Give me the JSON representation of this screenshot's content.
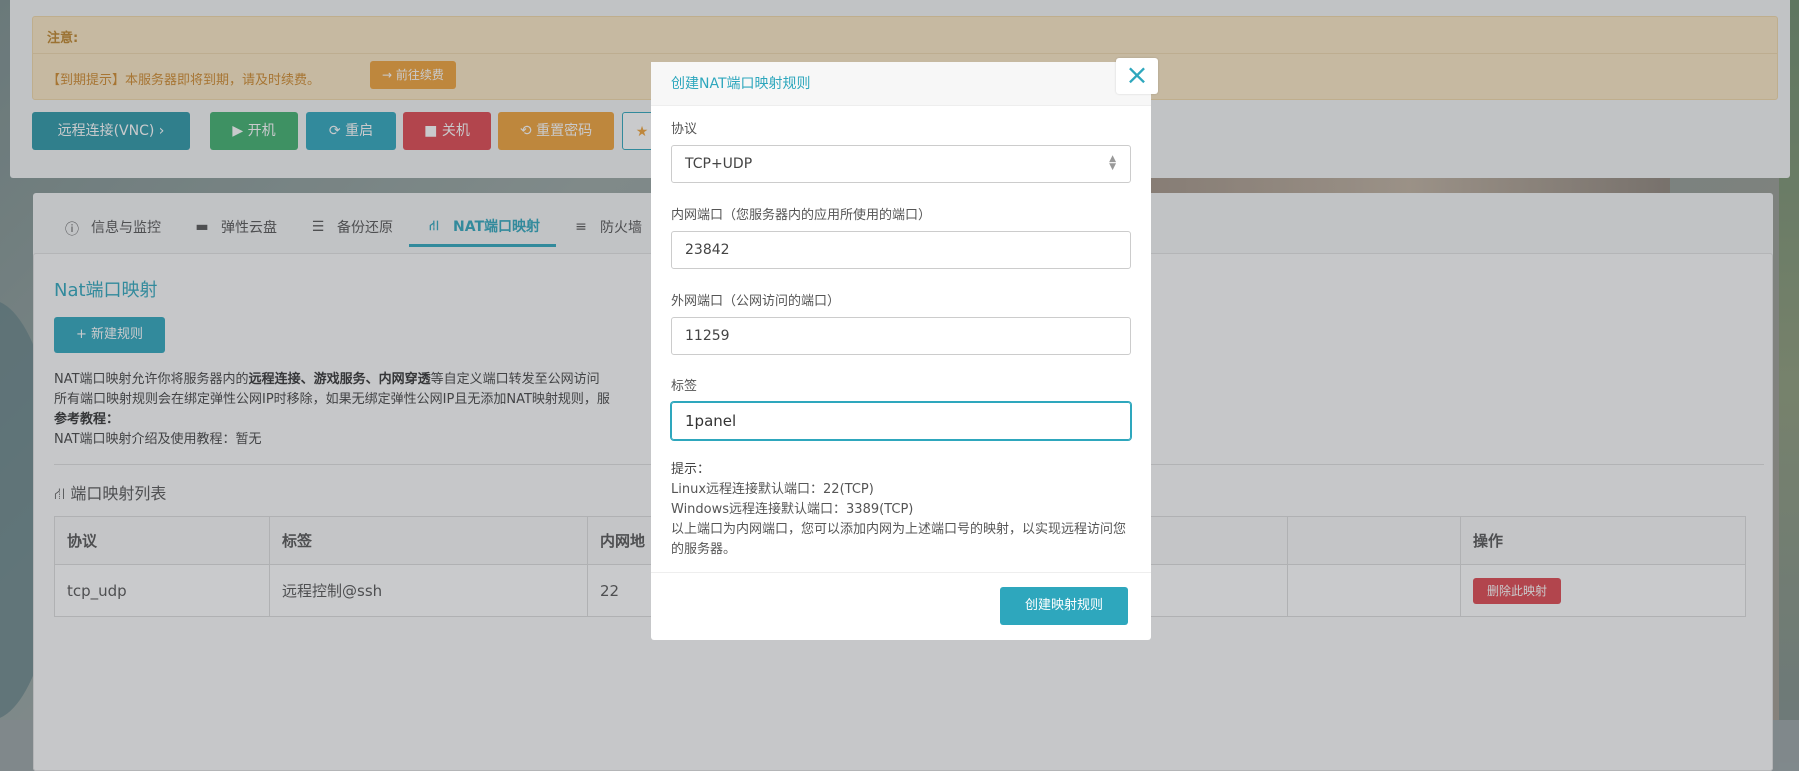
{
  "notice": {
    "title": "注意:",
    "message": "【到期提示】本服务器即将到期，请及时续费。",
    "renew_button": "→ 前往续费"
  },
  "actions": {
    "vnc": "远程连接(VNC)  ›",
    "power_on": "▶ 开机",
    "restart": "⟳ 重启",
    "power_off": "■ 关机",
    "reset_password": "⟲ 重置密码",
    "more": "★"
  },
  "tabs": [
    {
      "label": "信息与监控",
      "icon": "info-icon"
    },
    {
      "label": "弹性云盘",
      "icon": "disk-icon"
    },
    {
      "label": "备份还原",
      "icon": "server-icon"
    },
    {
      "label": "NAT端口映射",
      "icon": "sitemap-icon",
      "active": true
    },
    {
      "label": "防火墙",
      "icon": "list-icon"
    }
  ],
  "nat": {
    "heading": "Nat端口映射",
    "new_rule_button": "+ 新建规则",
    "desc_line1_pre": "NAT端口映射允许你将服务器内的",
    "desc_line1_bold": "远程连接、游戏服务、内网穿透",
    "desc_line1_post": "等自定义端口转发至公网访问",
    "desc_line2": "所有端口映射规则会在绑定弹性公网IP时移除，如果无绑定弹性公网IP且无添加NAT映射规则，服",
    "ref_title": "参考教程：",
    "ref_text": "NAT端口映射介绍及使用教程：暂无",
    "list_heading": "端口映射列表"
  },
  "table": {
    "headers": [
      "协议",
      "标签",
      "内网地",
      "",
      "操作"
    ],
    "rows": [
      {
        "protocol": "tcp_udp",
        "tag": "远程控制@ssh",
        "internal": "22",
        "delete": "删除此映射"
      }
    ]
  },
  "modal": {
    "title": "创建NAT端口映射规则",
    "close": "×",
    "protocol_label": "协议",
    "protocol_value": "TCP+UDP",
    "internal_label": "内网端口（您服务器内的应用所使用的端口）",
    "internal_value": "23842",
    "external_label": "外网端口（公网访问的端口）",
    "external_value": "11259",
    "tag_label": "标签",
    "tag_value": "1panel",
    "tips_title": "提示：",
    "tip1": "Linux远程连接默认端口：22(TCP)",
    "tip2": "Windows远程连接默认端口：3389(TCP)",
    "tip3": "以上端口为内网端口，您可以添加内网为上述端口号的映射，以实现远程访问您的服务器。",
    "submit": "创建映射规则"
  },
  "colors": {
    "accent": "#2ea7bd",
    "danger": "#e0474f",
    "warning": "#f0a33a",
    "success": "#3fb06e"
  }
}
